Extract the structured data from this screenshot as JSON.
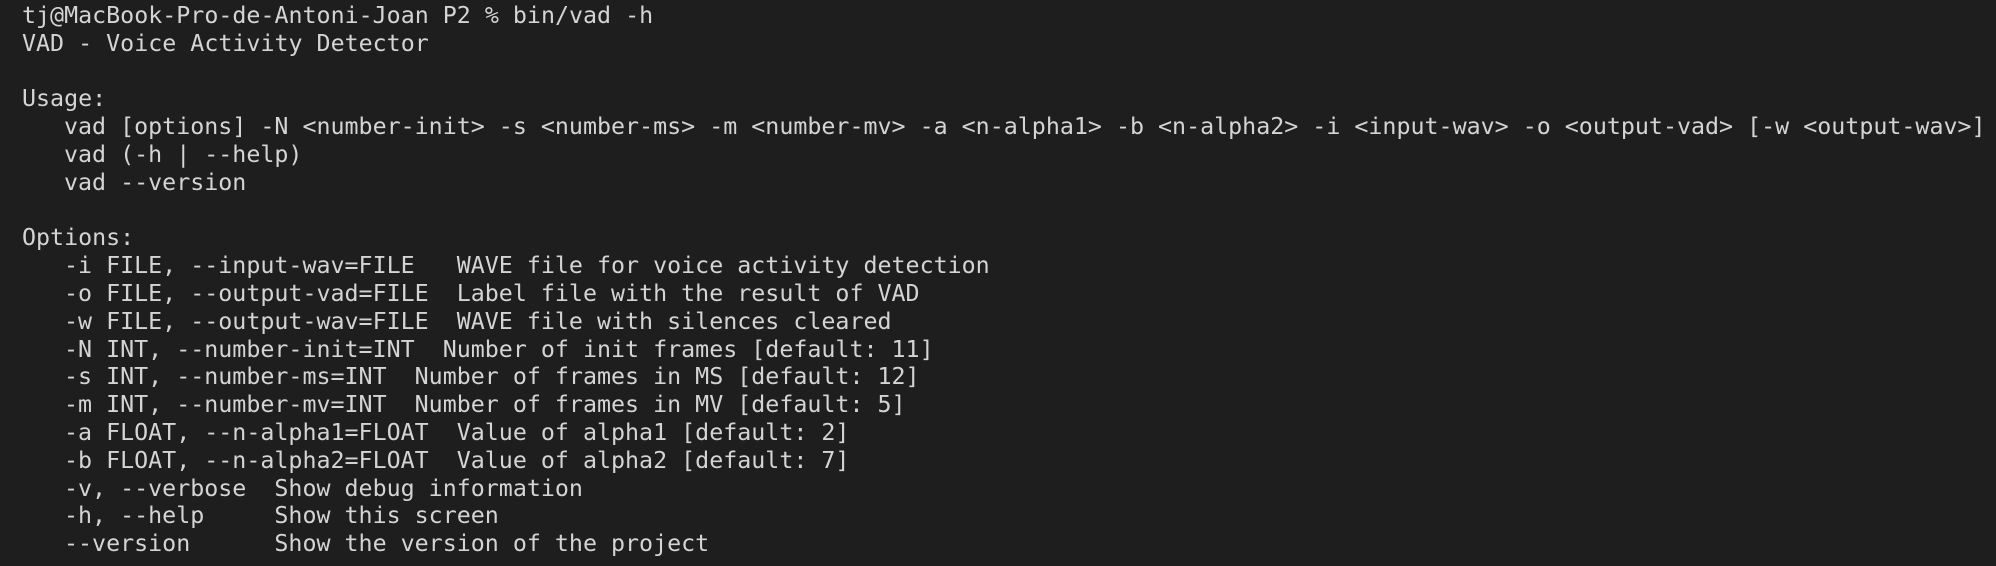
{
  "terminal": {
    "prompt": "tj@MacBook-Pro-de-Antoni-Joan P2 % bin/vad -h",
    "title_line": "VAD - Voice Activity Detector",
    "usage_header": "Usage:",
    "usage_lines": [
      "vad [options] -N <number-init> -s <number-ms> -m <number-mv> -a <n-alpha1> -b <n-alpha2> -i <input-wav> -o <output-vad> [-w <output-wav>]",
      "vad (-h | --help)",
      "vad --version"
    ],
    "options_header": "Options:",
    "option_lines": [
      "-i FILE, --input-wav=FILE   WAVE file for voice activity detection",
      "-o FILE, --output-vad=FILE  Label file with the result of VAD",
      "-w FILE, --output-wav=FILE  WAVE file with silences cleared",
      "-N INT, --number-init=INT  Number of init frames [default: 11]",
      "-s INT, --number-ms=INT  Number of frames in MS [default: 12]",
      "-m INT, --number-mv=INT  Number of frames in MV [default: 5]",
      "-a FLOAT, --n-alpha1=FLOAT  Value of alpha1 [default: 2]",
      "-b FLOAT, --n-alpha2=FLOAT  Value of alpha2 [default: 7]",
      "-v, --verbose  Show debug information",
      "-h, --help     Show this screen",
      "--version      Show the version of the project"
    ]
  }
}
